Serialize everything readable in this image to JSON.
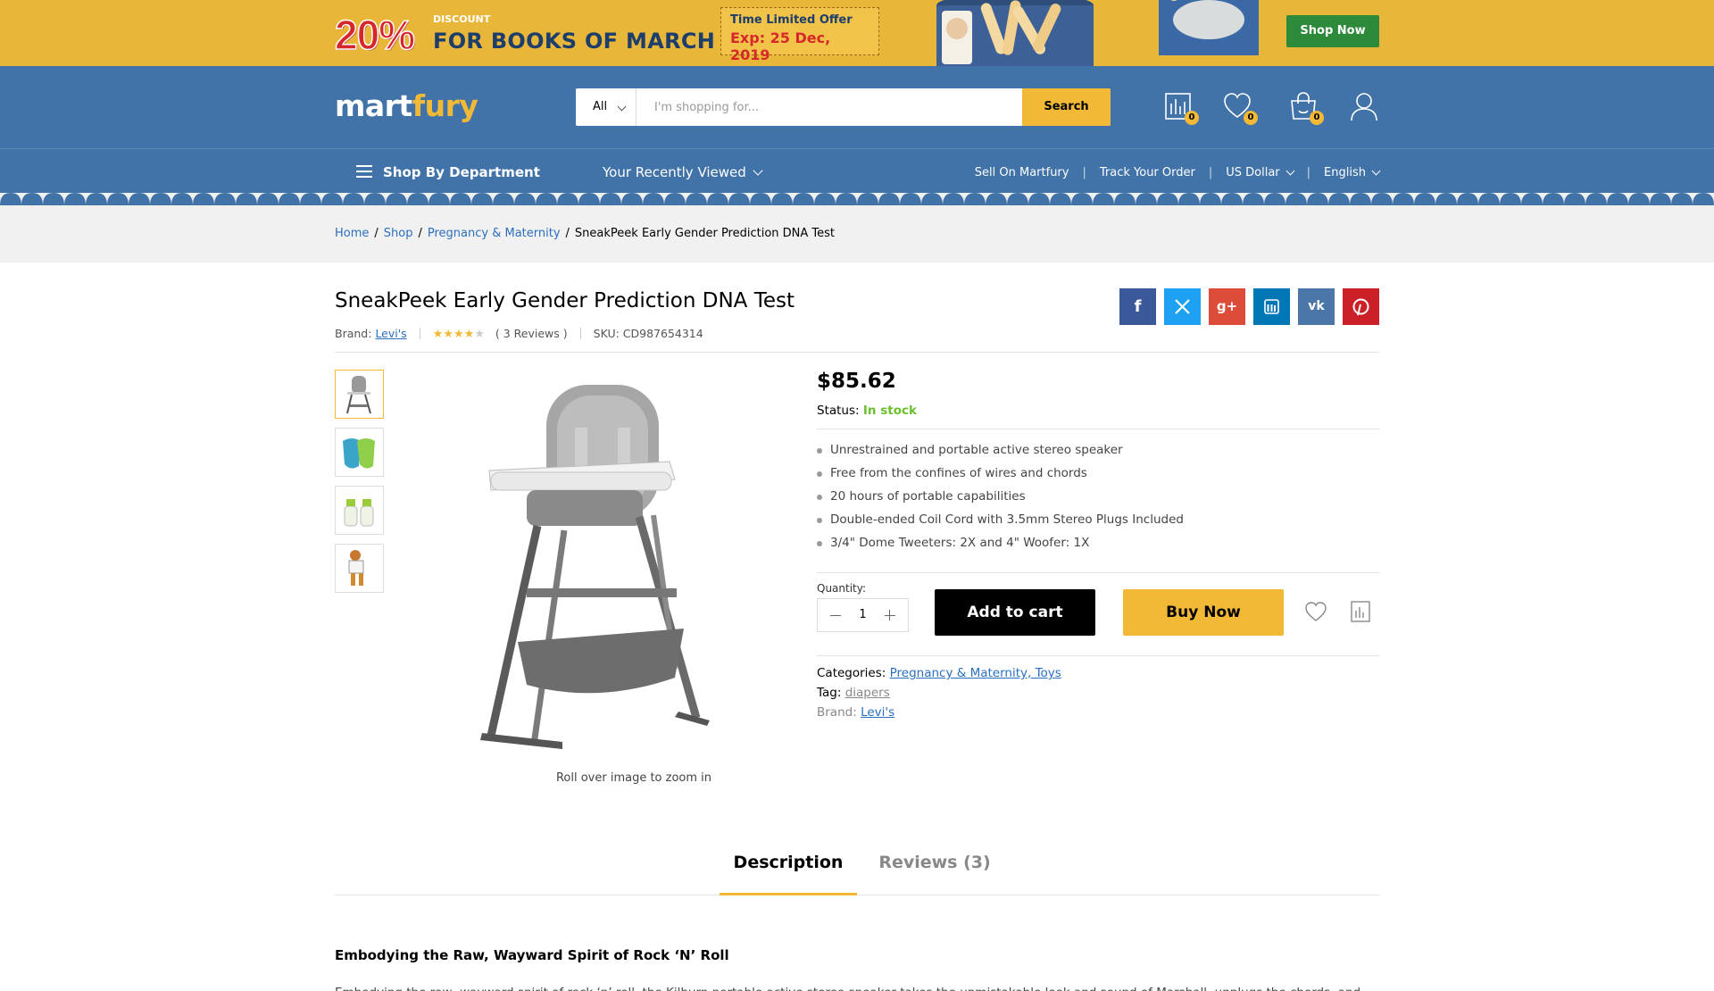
{
  "promo": {
    "percent": "20%",
    "discount": "DISCOUNT",
    "headline": "FOR BOOKS OF MARCH",
    "offer_title": "Time Limited Offer",
    "offer_expiry": "Exp: 25 Dec, 2019",
    "shop_now": "Shop Now"
  },
  "header": {
    "logo_a": "mart",
    "logo_b": "fury",
    "search_category": "All",
    "search_placeholder": "I'm shopping for...",
    "search_button": "Search",
    "compare_count": "0",
    "wishlist_count": "0",
    "cart_count": "0"
  },
  "nav": {
    "department": "Shop By Department",
    "recently_viewed": "Your Recently Viewed",
    "sell": "Sell On Martfury",
    "track": "Track Your Order",
    "currency": "US Dollar",
    "language": "English"
  },
  "breadcrumb": {
    "home": "Home",
    "shop": "Shop",
    "category": "Pregnancy & Maternity",
    "current": "SneakPeek Early Gender Prediction DNA Test"
  },
  "product": {
    "title": "SneakPeek Early Gender Prediction DNA Test",
    "brand_label": "Brand:",
    "brand": "Levi's",
    "rating": 4,
    "rating_max": 5,
    "reviews": "( 3 Reviews )",
    "sku": "SKU: CD987654314",
    "price": "$85.62",
    "status_label": "Status:",
    "status_value": "In stock",
    "features": [
      "Unrestrained and portable active stereo speaker",
      "Free from the confines of wires and chords",
      "20 hours of portable capabilities",
      "Double-ended Coil Cord with 3.5mm Stereo Plugs Included",
      "3/4\" Dome Tweeters: 2X and 4\" Woofer: 1X"
    ],
    "quantity_label": "Quantity:",
    "quantity": "1",
    "add_to_cart": "Add to cart",
    "buy_now": "Buy Now",
    "categories_label": "Categories:",
    "categories": "Pregnancy & Maternity, Toys",
    "tag_label": "Tag:",
    "tag": "diapers",
    "brand2_label": "Brand:",
    "zoom_hint": "Roll over image to zoom in"
  },
  "tabs": {
    "description": "Description",
    "reviews": "Reviews (3)"
  },
  "description": {
    "heading": "Embodying the Raw, Wayward Spirit of Rock ‘N’ Roll",
    "text": "Embodying the raw, wayward spirit of rock ‘n’ roll, the Kilburn portable active stereo speaker takes the unmistakable look and sound of Marshall, unplugs the chords, and"
  },
  "colors": {
    "accent": "#f2b936",
    "header_blue": "#4173a8",
    "promo_bg": "#e8b73a",
    "in_stock": "#6bbf2d",
    "link": "#2a6fbf"
  }
}
